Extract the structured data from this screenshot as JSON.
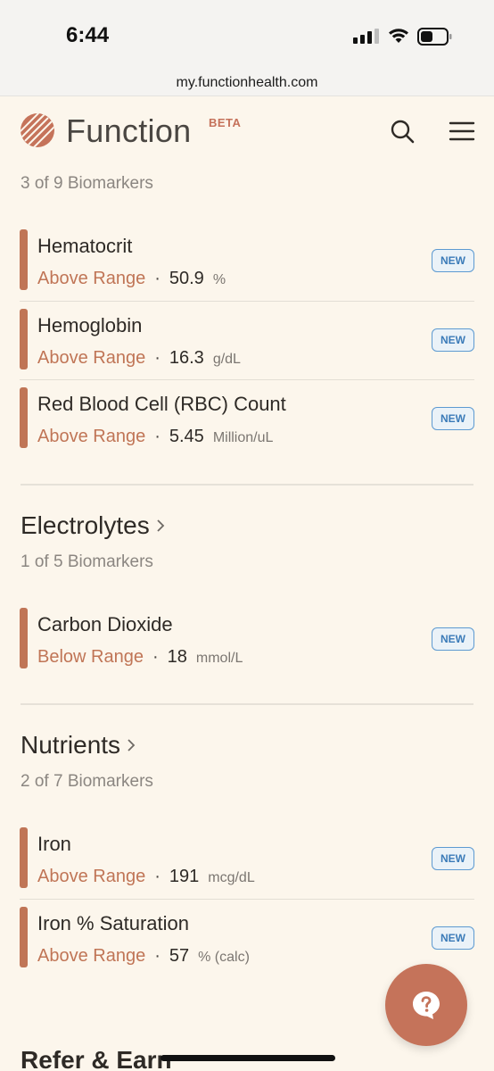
{
  "status_bar": {
    "time": "6:44",
    "url": "my.functionhealth.com"
  },
  "header": {
    "logo_text": "Function",
    "beta_label": "BETA"
  },
  "sections": {
    "blood": {
      "count": "3 of 9 Biomarkers",
      "items": [
        {
          "name": "Hematocrit",
          "status": "Above Range",
          "value": "50.9",
          "unit": "%",
          "badge": "NEW"
        },
        {
          "name": "Hemoglobin",
          "status": "Above Range",
          "value": "16.3",
          "unit": "g/dL",
          "badge": "NEW"
        },
        {
          "name": "Red Blood Cell (RBC) Count",
          "status": "Above Range",
          "value": "5.45",
          "unit": "Million/uL",
          "badge": "NEW"
        }
      ]
    },
    "electrolytes": {
      "title": "Electrolytes",
      "count": "1 of 5 Biomarkers",
      "items": [
        {
          "name": "Carbon Dioxide",
          "status": "Below Range",
          "value": "18",
          "unit": "mmol/L",
          "badge": "NEW"
        }
      ]
    },
    "nutrients": {
      "title": "Nutrients",
      "count": "2 of 7 Biomarkers",
      "items": [
        {
          "name": "Iron",
          "status": "Above Range",
          "value": "191",
          "unit": "mcg/dL",
          "badge": "NEW"
        },
        {
          "name": "Iron % Saturation",
          "status": "Above Range",
          "value": "57",
          "unit": "% (calc)",
          "badge": "NEW"
        }
      ]
    },
    "refer": {
      "title": "Refer & Earn"
    }
  },
  "separator": "·",
  "colors": {
    "accent": "#C07556",
    "badge": "#3B7BB8",
    "background": "#FCF6EC"
  }
}
